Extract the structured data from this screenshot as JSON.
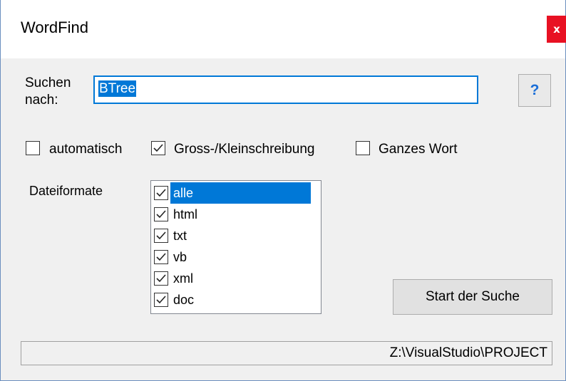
{
  "window": {
    "title": "WordFind",
    "close_label": "x"
  },
  "search": {
    "label_line1": "Suchen",
    "label_line2": "nach:",
    "value": "BTree",
    "help_label": "?"
  },
  "options": [
    {
      "label": "automatisch",
      "checked": false
    },
    {
      "label": "Gross-/Kleinschreibung",
      "checked": true
    },
    {
      "label": "Ganzes Wort",
      "checked": false
    }
  ],
  "formats": {
    "label": "Dateiformate",
    "items": [
      {
        "label": "alle",
        "checked": true,
        "selected": true
      },
      {
        "label": "html",
        "checked": true,
        "selected": false
      },
      {
        "label": "txt",
        "checked": true,
        "selected": false
      },
      {
        "label": "vb",
        "checked": true,
        "selected": false
      },
      {
        "label": "xml",
        "checked": true,
        "selected": false
      },
      {
        "label": "doc",
        "checked": true,
        "selected": false
      }
    ]
  },
  "start_button": "Start der Suche",
  "status_path": "Z:\\VisualStudio\\PROJECT",
  "colors": {
    "accent": "#0078d7",
    "close": "#e81123",
    "help_glyph": "#1b6fd8"
  }
}
